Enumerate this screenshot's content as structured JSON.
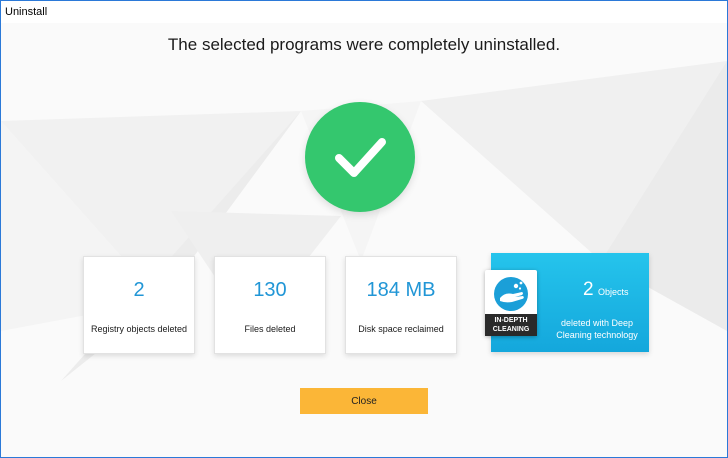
{
  "window": {
    "title": "Uninstall"
  },
  "headline": "The selected programs were completely uninstalled.",
  "cards": [
    {
      "value": "2",
      "label": "Registry objects deleted"
    },
    {
      "value": "130",
      "label": "Files deleted"
    },
    {
      "value": "184 MB",
      "label": "Disk space reclaimed"
    }
  ],
  "deep_cleaning": {
    "badge_line1": "IN-DEPTH",
    "badge_line2": "CLEANING",
    "count": "2",
    "unit": "Objects",
    "description": "deleted with Deep Cleaning technology"
  },
  "close_label": "Close",
  "colors": {
    "success": "#34c76e",
    "accent": "#2196d6",
    "deep_card": "#1cb6e6",
    "button": "#fbb637",
    "border": "#2b79d8"
  }
}
